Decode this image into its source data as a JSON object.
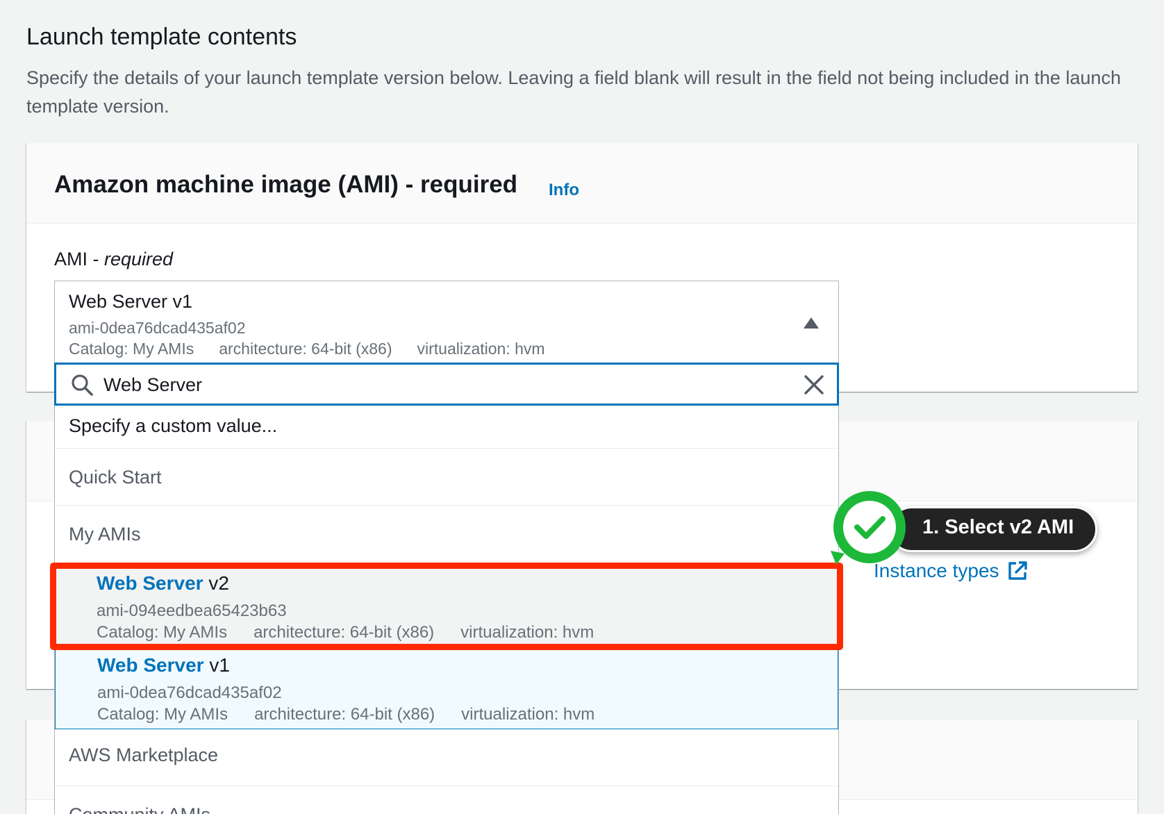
{
  "section": {
    "title": "Launch template contents",
    "description": "Specify the details of your launch template version below. Leaving a field blank will result in the field not being included in the launch template version."
  },
  "ami_card": {
    "title": "Amazon machine image (AMI) - required",
    "info_link": "Info"
  },
  "ami_field": {
    "label_main": "AMI - ",
    "label_required": "required",
    "selected": {
      "name": "Web Server v1",
      "id": "ami-0dea76dcad435af02",
      "catalog": "Catalog: My AMIs",
      "architecture": "architecture: 64-bit (x86)",
      "virtualization": "virtualization: hvm"
    }
  },
  "search": {
    "value": "Web Server",
    "icon": "search-icon",
    "clear_icon": "close-icon"
  },
  "dropdown": {
    "custom_value": "Specify a custom value...",
    "groups": {
      "quick_start": "Quick Start",
      "my_amis": "My AMIs",
      "aws_marketplace": "AWS Marketplace",
      "community_amis": "Community AMIs"
    },
    "options": [
      {
        "name_match": "Web Server",
        "name_rest": " v2",
        "id": "ami-094eedbea65423b63",
        "catalog": "Catalog: My AMIs",
        "architecture": "architecture: 64-bit (x86)",
        "virtualization": "virtualization: hvm"
      },
      {
        "name_match": "Web Server",
        "name_rest": " v1",
        "id": "ami-0dea76dcad435af02",
        "catalog": "Catalog: My AMIs",
        "architecture": "architecture: 64-bit (x86)",
        "virtualization": "virtualization: hvm"
      }
    ]
  },
  "callout": {
    "text": "1. Select v2 AMI",
    "badge_icon": "checkmark-icon",
    "badge_color": "#1db83a"
  },
  "instance_types": {
    "link": "Instance types",
    "icon": "external-link-icon"
  },
  "colors": {
    "link_blue": "#0073bb",
    "highlight_red": "#ff2a00",
    "page_bg": "#f2f3f3"
  }
}
